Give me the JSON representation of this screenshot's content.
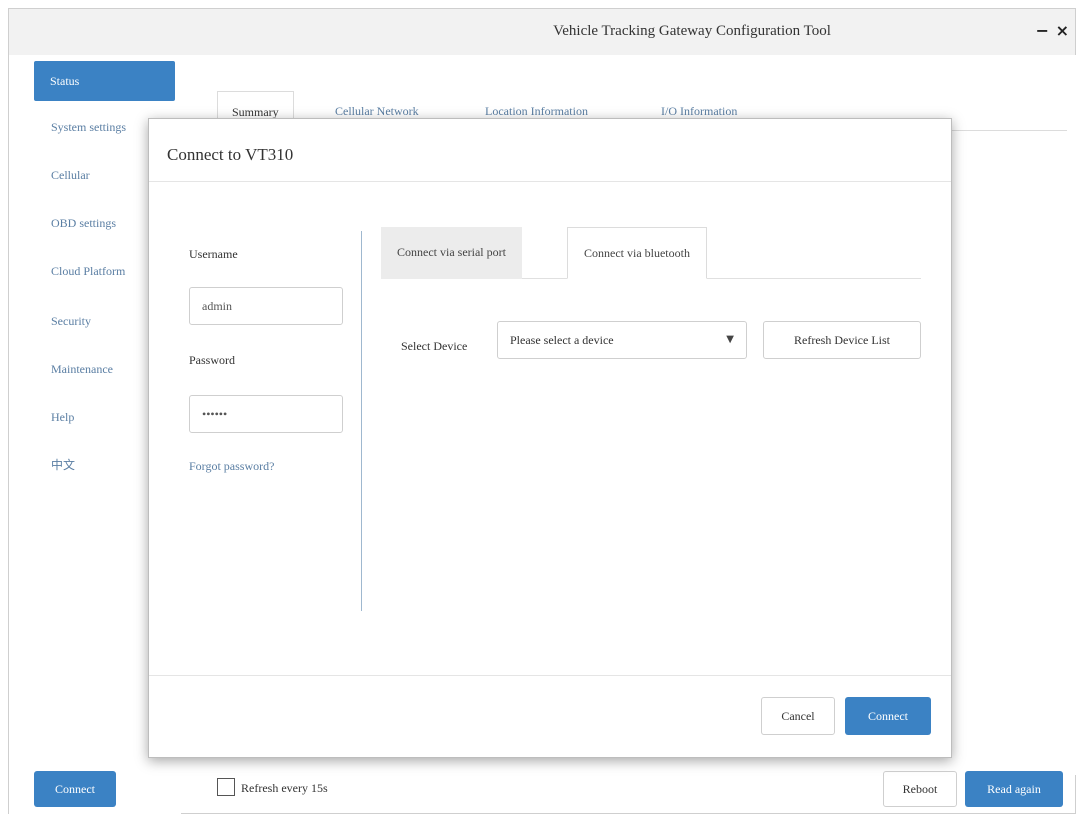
{
  "window": {
    "title": "Vehicle Tracking Gateway Configuration Tool",
    "minimize_glyph": "−",
    "close_glyph": "×"
  },
  "sidebar": {
    "items": [
      {
        "label": "Status",
        "active": true
      },
      {
        "label": "System settings",
        "active": false
      },
      {
        "label": "Cellular",
        "active": false
      },
      {
        "label": "OBD settings",
        "active": false
      },
      {
        "label": "Cloud Platform",
        "active": false
      },
      {
        "label": "Security",
        "active": false
      },
      {
        "label": "Maintenance",
        "active": false
      },
      {
        "label": "Help",
        "active": false
      },
      {
        "label": "中文",
        "active": false
      }
    ]
  },
  "main": {
    "tabs": [
      {
        "label": "Summary",
        "active": true
      },
      {
        "label": "Cellular Network",
        "active": false
      },
      {
        "label": "Location Information",
        "active": false
      },
      {
        "label": "I/O Information",
        "active": false
      }
    ]
  },
  "bottom": {
    "connect_label": "Connect",
    "refresh_checkbox_label": "Refresh every 15s",
    "refresh_checked": false,
    "reboot_label": "Reboot",
    "read_again_label": "Read again"
  },
  "dialog": {
    "title": "Connect to VT310",
    "username_label": "Username",
    "username_value": "admin",
    "password_label": "Password",
    "password_value": "••••••",
    "forgot_password": "Forgot password?",
    "tabs": [
      {
        "label": "Connect via serial port",
        "active": false
      },
      {
        "label": "Connect via bluetooth",
        "active": true
      }
    ],
    "select_device_label": "Select Device",
    "select_device_placeholder": "Please select a device",
    "refresh_device_list": "Refresh Device List",
    "cancel_label": "Cancel",
    "connect_label": "Connect"
  },
  "colors": {
    "accent": "#3b82c4",
    "link": "#5a7ea3"
  }
}
